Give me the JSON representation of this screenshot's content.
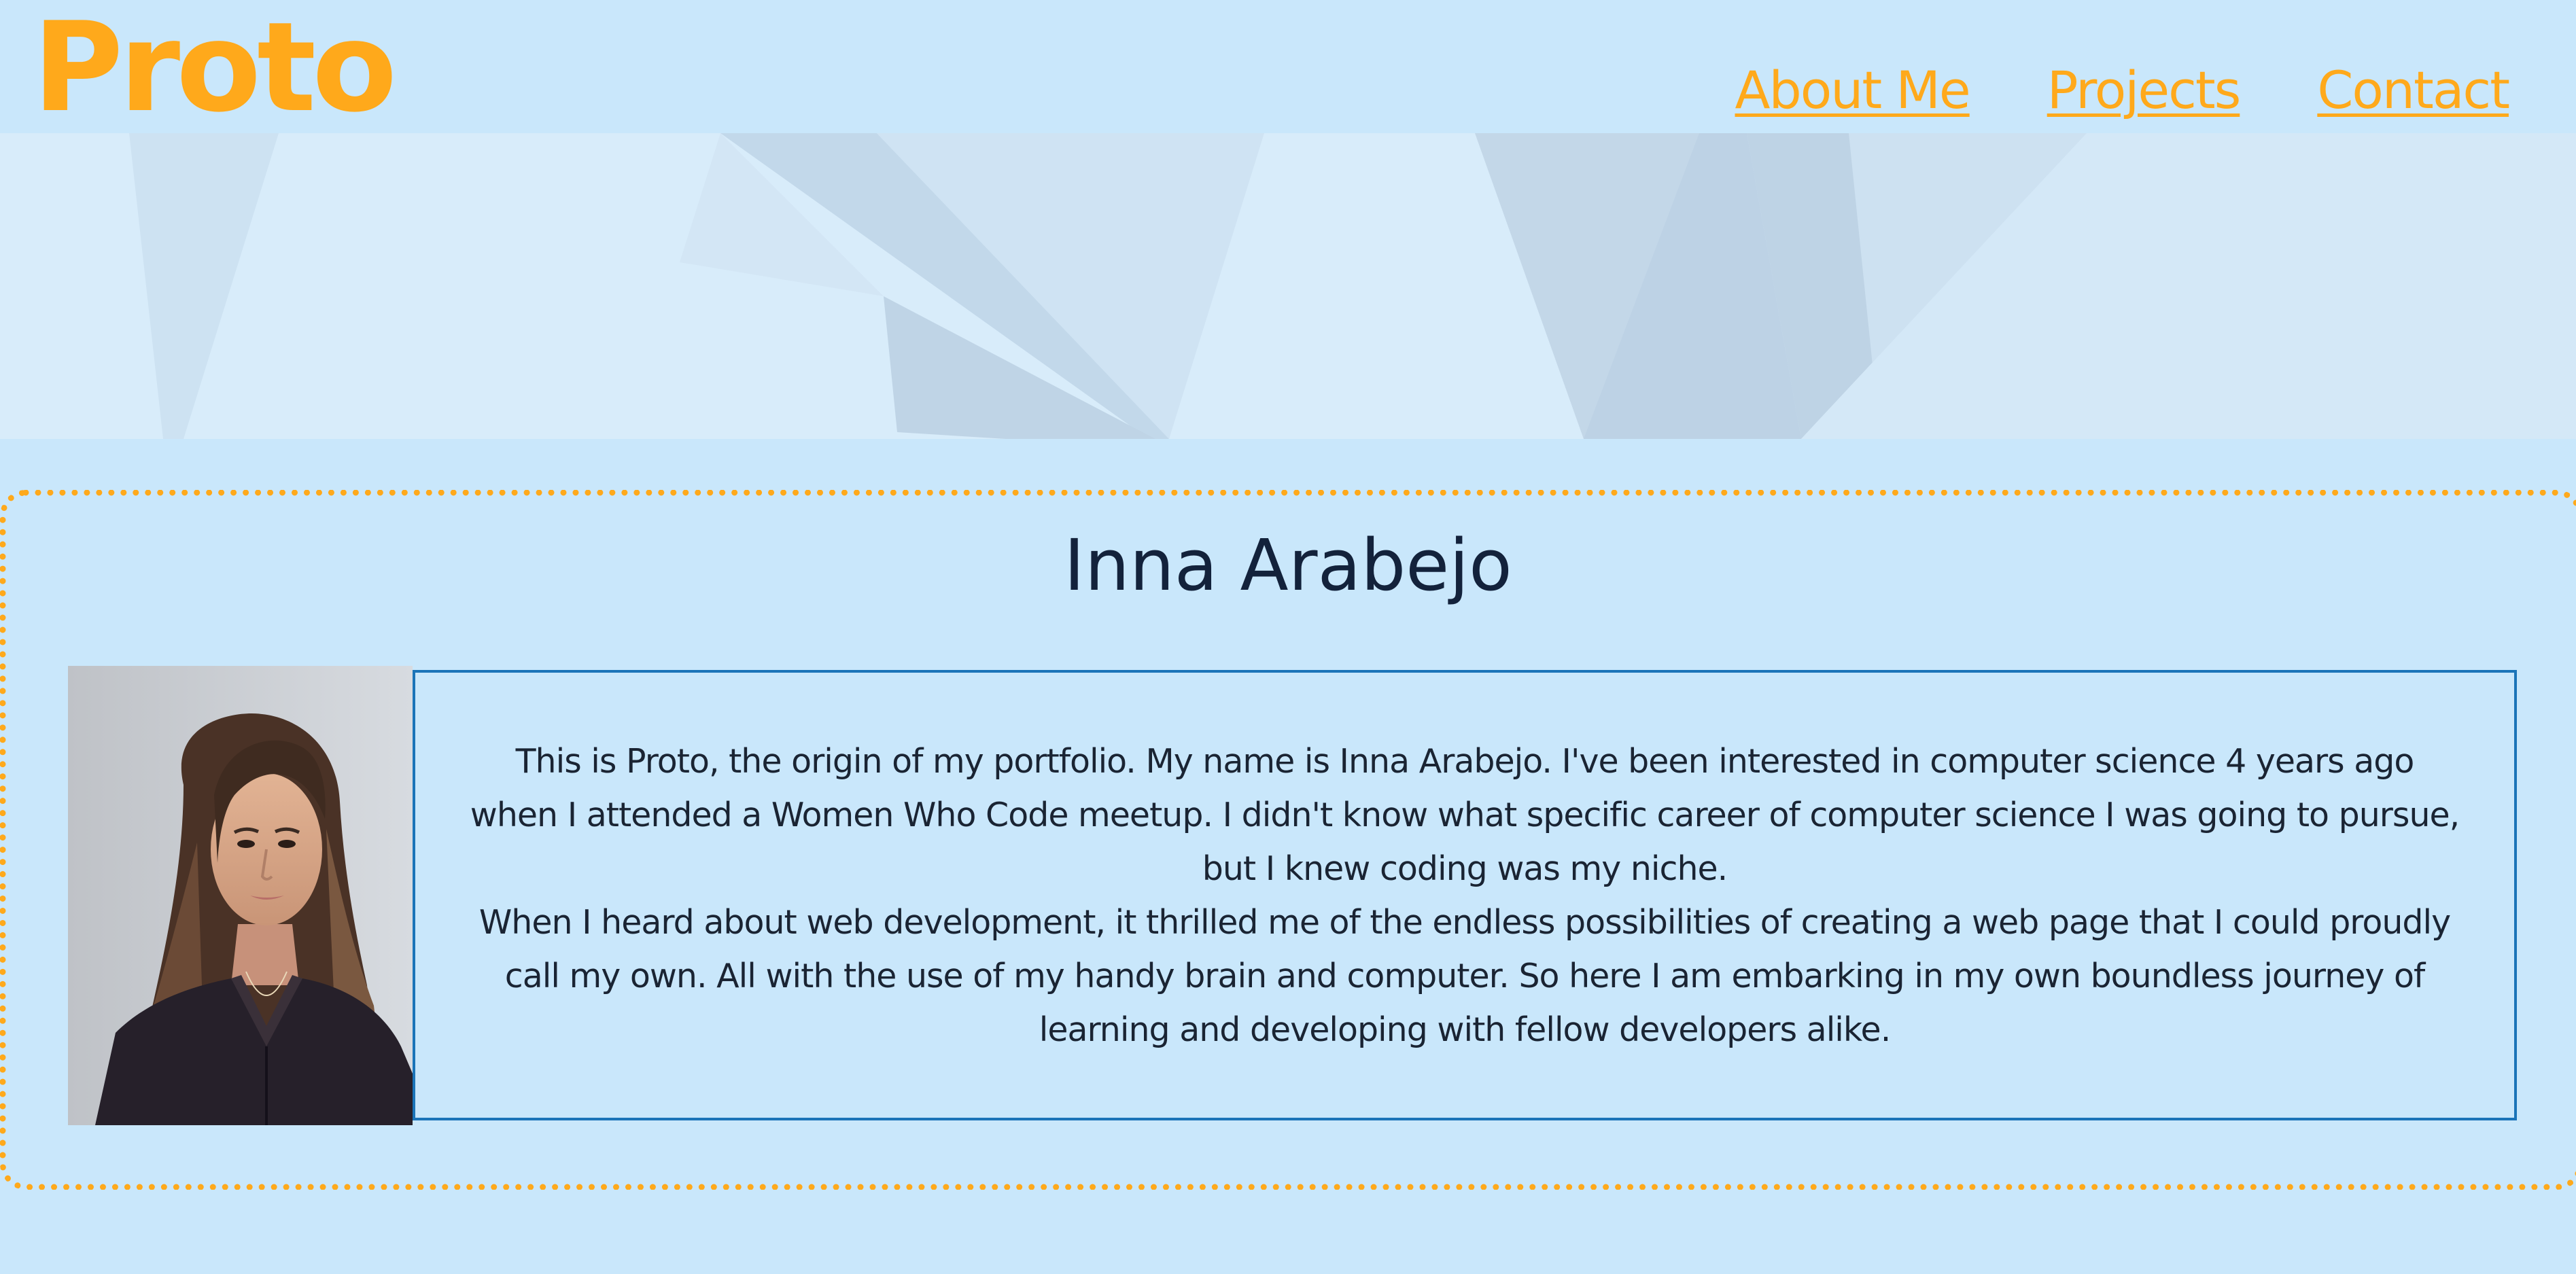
{
  "header": {
    "logo": "Proto",
    "nav": [
      {
        "label": "About Me"
      },
      {
        "label": "Projects"
      },
      {
        "label": "Contact"
      }
    ]
  },
  "about": {
    "name": "Inna Arabejo",
    "paragraphs": [
      "This is Proto, the origin of my portfolio. My name is Inna Arabejo. I've been interested in computer science 4 years ago when I attended a Women Who Code meetup. I didn't know what specific career of computer science I was going to pursue, but I knew coding was my niche.",
      "When I heard about web development, it thrilled me of the endless possibilities of creating a web page that I could proudly call my own. All with the use of my handy brain and computer. So here I am embarking in my own boundless journey of learning and developing with fellow developers alike."
    ]
  },
  "colors": {
    "background": "#c9e7fb",
    "accent": "#ffa91b",
    "text": "#13223b",
    "bio_border": "#1b74b8"
  }
}
